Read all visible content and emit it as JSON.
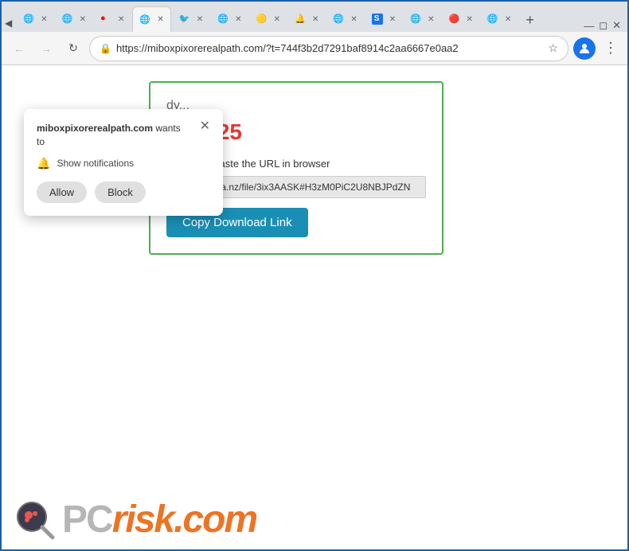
{
  "browser": {
    "address": "https://miboxpixorerealpath.com/?t=744f3b2d7291baf8914c2aa6667e0aa2",
    "nav_back": "←",
    "nav_forward": "→",
    "nav_refresh": "↻",
    "nav_menu": "⋮",
    "star": "☆"
  },
  "tabs": [
    {
      "id": "t1",
      "favicon": "◀",
      "label": "",
      "active": false
    },
    {
      "id": "t2",
      "favicon": "🌐",
      "label": "",
      "active": false
    },
    {
      "id": "t3",
      "favicon": "🔴",
      "label": "",
      "active": false
    },
    {
      "id": "t4",
      "favicon": "",
      "label": "",
      "active": true
    },
    {
      "id": "t5",
      "favicon": "🐦",
      "label": "",
      "active": false
    },
    {
      "id": "t6",
      "favicon": "🌐",
      "label": "",
      "active": false
    },
    {
      "id": "t7",
      "favicon": "🟡",
      "label": "",
      "active": false
    },
    {
      "id": "t8",
      "favicon": "🔔",
      "label": "",
      "active": false
    },
    {
      "id": "t9",
      "favicon": "🌐",
      "label": "",
      "active": false
    },
    {
      "id": "t10",
      "favicon": "🌐",
      "label": "",
      "active": false
    },
    {
      "id": "t11",
      "favicon": "S",
      "label": "",
      "active": false
    },
    {
      "id": "t12",
      "favicon": "🌐",
      "label": "",
      "active": false
    },
    {
      "id": "t13",
      "favicon": "🔴",
      "label": "",
      "active": false
    },
    {
      "id": "t14",
      "favicon": "🌐",
      "label": "",
      "active": false
    },
    {
      "id": "t15",
      "favicon": "🌐",
      "label": "",
      "active": false
    }
  ],
  "notification": {
    "domain": "miboxpixorerealpath.com",
    "wants_text": "wants",
    "to_text": "to",
    "show_text": "Show notifications",
    "allow_label": "Allow",
    "block_label": "Block"
  },
  "download_box": {
    "ready_text": "dy...",
    "year_label": "s: 2025",
    "instruction": "Copy and paste the URL in browser",
    "url_value": "https://mega.nz/file/3ix3AASK#H3zM0PiC2U8NBJPdZN",
    "copy_button": "Copy Download Link"
  },
  "watermark": {
    "pc_text": "PC",
    "risk_text": "risk.com"
  }
}
